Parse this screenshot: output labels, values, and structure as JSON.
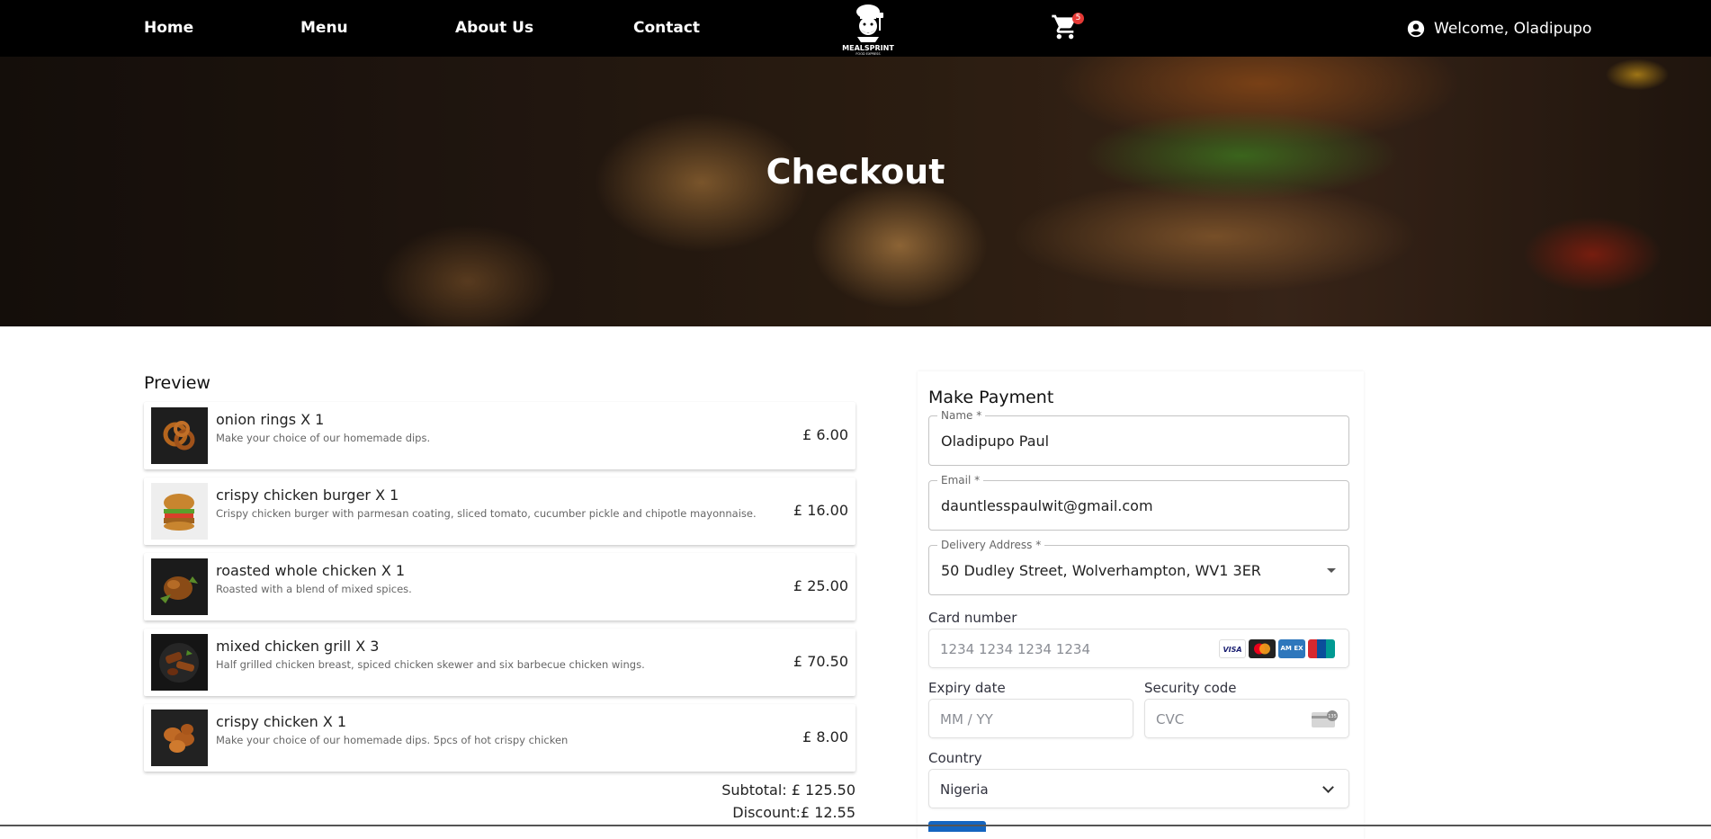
{
  "nav": {
    "links": [
      "Home",
      "Menu",
      "About Us",
      "Contact"
    ],
    "logo_text": "MEALSPRINT",
    "logo_subtext": "FOOD EXPRESS",
    "cart_count": "5",
    "welcome": "Welcome, Oladipupo"
  },
  "hero": {
    "title": "Checkout"
  },
  "preview": {
    "title": "Preview",
    "items": [
      {
        "name": "onion rings X 1",
        "description": "Make your choice of our homemade dips.",
        "price": "£ 6.00",
        "food": "onion-rings"
      },
      {
        "name": "crispy chicken burger X 1",
        "description": "Crispy chicken burger with parmesan coating, sliced tomato, cucumber pickle and chipotle mayonnaise.",
        "price": "£ 16.00",
        "food": "burger"
      },
      {
        "name": "roasted whole chicken X 1",
        "description": "Roasted with a blend of mixed spices.",
        "price": "£ 25.00",
        "food": "roasted-chicken"
      },
      {
        "name": "mixed chicken grill X 3",
        "description": "Half grilled chicken breast, spiced chicken skewer and six barbecue chicken wings.",
        "price": "£ 70.50",
        "food": "chicken-grill"
      },
      {
        "name": "crispy chicken X 1",
        "description": "Make your choice of our homemade dips. 5pcs of hot crispy chicken",
        "price": "£ 8.00",
        "food": "crispy-chicken"
      }
    ],
    "subtotal": "Subtotal: £ 125.50",
    "discount": "Discount:£ 12.55"
  },
  "payment": {
    "title": "Make Payment",
    "name_label": "Name *",
    "name_value": "Oladipupo Paul",
    "email_label": "Email *",
    "email_value": "dauntlesspaulwit@gmail.com",
    "address_label": "Delivery Address *",
    "address_value": "50 Dudley Street, Wolverhampton, WV1 3ER",
    "card_label": "Card number",
    "card_placeholder": "1234 1234 1234 1234",
    "card_brands": [
      "VISA",
      "MC",
      "AMEX",
      "UnionPay"
    ],
    "expiry_label": "Expiry date",
    "expiry_placeholder": "MM / YY",
    "cvc_label": "Security code",
    "cvc_placeholder": "CVC",
    "cvc_badge": "135",
    "country_label": "Country",
    "country_value": "Nigeria"
  },
  "colors": {
    "nav_bg": "#000000",
    "cart_badge": "#e53935",
    "pay_button": "#1565c0",
    "visa": "#1a1f71",
    "mastercard_red": "#eb001b",
    "mastercard_orange": "#f79e1b",
    "amex": "#2e77bc"
  }
}
